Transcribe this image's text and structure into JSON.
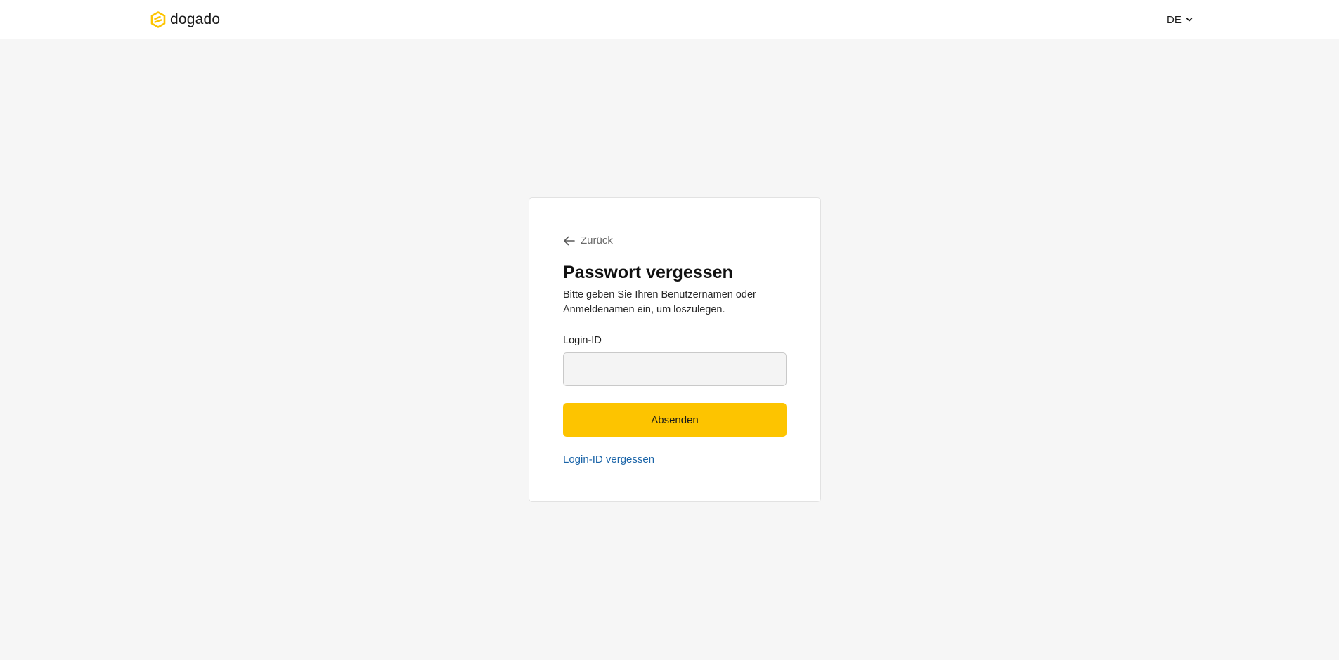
{
  "header": {
    "logo_text": "dogado",
    "language": "DE",
    "brand_color": "#fdc400"
  },
  "card": {
    "back_label": "Zurück",
    "title": "Passwort vergessen",
    "description": "Bitte geben Sie Ihren Benutzernamen oder Anmeldenamen ein, um loszulegen.",
    "field_label": "Login-ID",
    "field_value": "",
    "field_placeholder": "",
    "submit_label": "Absenden",
    "forgot_link": "Login-ID vergessen"
  }
}
